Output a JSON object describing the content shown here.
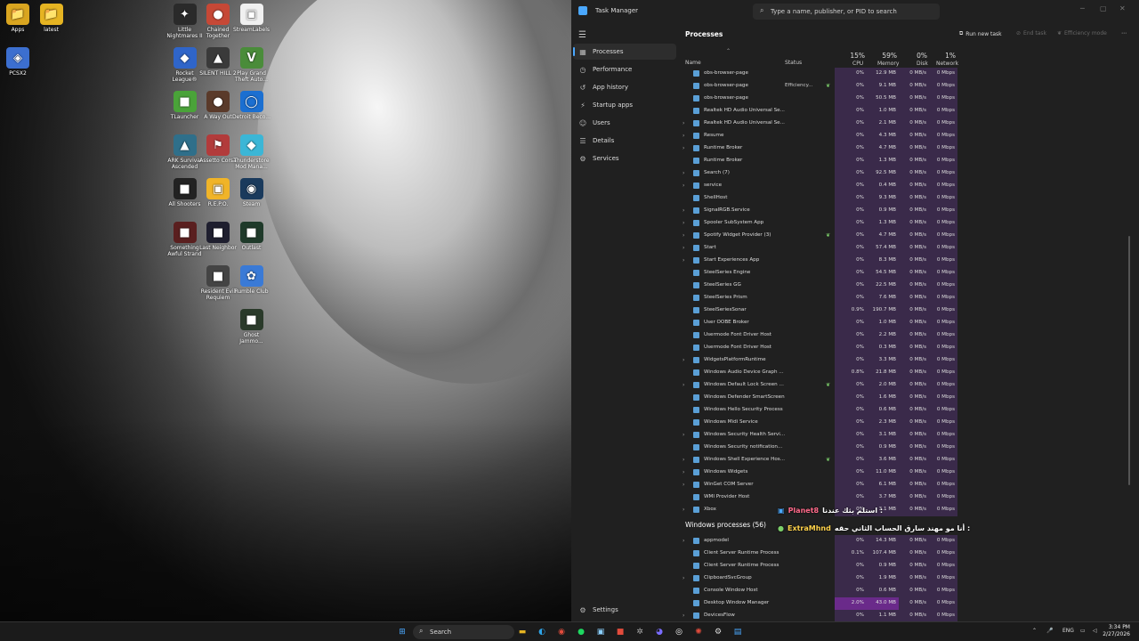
{
  "desktop": {
    "icons": [
      {
        "label": "Apps",
        "glyph": "📁",
        "color": "#d9a520"
      },
      {
        "label": "latest",
        "glyph": "📁",
        "color": "#e6b422"
      },
      {
        "label": "PCSX2",
        "glyph": "◈",
        "color": "#3c6fcf"
      },
      {
        "label": "Little Nightmares II",
        "glyph": "✦",
        "color": "#2a2a2a"
      },
      {
        "label": "Chained Together",
        "glyph": "●",
        "color": "#c64836"
      },
      {
        "label": "StreamLabels",
        "glyph": "▣",
        "color": "#f0f0f0"
      },
      {
        "label": "Rocket League®",
        "glyph": "◆",
        "color": "#2f65c9"
      },
      {
        "label": "SILENT HILL 2",
        "glyph": "▲",
        "color": "#3a3a3a"
      },
      {
        "label": "Play Grand Theft Auto...",
        "glyph": "V",
        "color": "#4a8c3a"
      },
      {
        "label": "TLauncher",
        "glyph": "■",
        "color": "#4aa339"
      },
      {
        "label": "A Way Out",
        "glyph": "●",
        "color": "#5a3a2a"
      },
      {
        "label": "Detroit Beco...",
        "glyph": "◯",
        "color": "#1b6fd1"
      },
      {
        "label": "ARK Survival Ascended",
        "glyph": "▲",
        "color": "#2f6f8a"
      },
      {
        "label": "Assetto Corsa",
        "glyph": "⚑",
        "color": "#b23b3b"
      },
      {
        "label": "Thunderstore Mod Mana...",
        "glyph": "◆",
        "color": "#3bb6d6"
      },
      {
        "label": "All Shooters",
        "glyph": "■",
        "color": "#222222"
      },
      {
        "label": "R.E.P.O.",
        "glyph": "▣",
        "color": "#f0b428"
      },
      {
        "label": "Steam",
        "glyph": "◉",
        "color": "#1a3a5c"
      },
      {
        "label": "Something Awful Strand",
        "glyph": "■",
        "color": "#5a1f1f"
      },
      {
        "label": "Last Neighbor",
        "glyph": "■",
        "color": "#1f1f2f"
      },
      {
        "label": "Outlast",
        "glyph": "■",
        "color": "#1f3a2a"
      },
      {
        "label": "Resident Evil Requiem",
        "glyph": "■",
        "color": "#444444"
      },
      {
        "label": "Rumble Club",
        "glyph": "✿",
        "color": "#3a7ad6"
      },
      {
        "label": "Ghost Jammo...",
        "glyph": "■",
        "color": "#2a3a2a"
      }
    ]
  },
  "taskmanager": {
    "title": "Task Manager",
    "search_placeholder": "Type a name, publisher, or PID to search",
    "nav": [
      {
        "label": "Processes",
        "icon": "▦"
      },
      {
        "label": "Performance",
        "icon": "◷"
      },
      {
        "label": "App history",
        "icon": "↺"
      },
      {
        "label": "Startup apps",
        "icon": "⚡"
      },
      {
        "label": "Users",
        "icon": "☺"
      },
      {
        "label": "Details",
        "icon": "☰"
      },
      {
        "label": "Services",
        "icon": "⚙"
      }
    ],
    "settings_label": "Settings",
    "page_title": "Processes",
    "run_new_task": "Run new task",
    "end_task": "End task",
    "efficiency_mode": "Efficiency mode",
    "columns": {
      "name": "Name",
      "status": "Status",
      "cpu_pct": "15%",
      "cpu": "CPU",
      "mem_pct": "59%",
      "mem": "Memory",
      "disk_pct": "0%",
      "disk": "Disk",
      "net_pct": "1%",
      "net": "Network"
    },
    "rows": [
      {
        "name": "obs-browser-page",
        "status": "",
        "cpu": "0%",
        "mem": "12.9 MB",
        "disk": "0 MB/s",
        "net": "0 Mbps",
        "exp": false
      },
      {
        "name": "obs-browser-page",
        "status": "Efficiency...",
        "leaf": true,
        "cpu": "0%",
        "mem": "9.1 MB",
        "disk": "0 MB/s",
        "net": "0 Mbps",
        "exp": false
      },
      {
        "name": "obs-browser-page",
        "status": "",
        "cpu": "0%",
        "mem": "50.5 MB",
        "disk": "0 MB/s",
        "net": "0 Mbps",
        "exp": false
      },
      {
        "name": "Realtek HD Audio Universal Se...",
        "status": "",
        "cpu": "0%",
        "mem": "1.0 MB",
        "disk": "0 MB/s",
        "net": "0 Mbps",
        "exp": false
      },
      {
        "name": "Realtek HD Audio Universal Se...",
        "status": "",
        "cpu": "0%",
        "mem": "2.1 MB",
        "disk": "0 MB/s",
        "net": "0 Mbps",
        "exp": true
      },
      {
        "name": "Resume",
        "status": "",
        "cpu": "0%",
        "mem": "4.3 MB",
        "disk": "0 MB/s",
        "net": "0 Mbps",
        "exp": true
      },
      {
        "name": "Runtime Broker",
        "status": "",
        "cpu": "0%",
        "mem": "4.7 MB",
        "disk": "0 MB/s",
        "net": "0 Mbps",
        "exp": true
      },
      {
        "name": "Runtime Broker",
        "status": "",
        "cpu": "0%",
        "mem": "1.3 MB",
        "disk": "0 MB/s",
        "net": "0 Mbps",
        "exp": false
      },
      {
        "name": "Search (7)",
        "status": "",
        "cpu": "0%",
        "mem": "92.5 MB",
        "disk": "0 MB/s",
        "net": "0 Mbps",
        "exp": true
      },
      {
        "name": "service",
        "status": "",
        "cpu": "0%",
        "mem": "0.4 MB",
        "disk": "0 MB/s",
        "net": "0 Mbps",
        "exp": true
      },
      {
        "name": "ShellHost",
        "status": "",
        "cpu": "0%",
        "mem": "9.3 MB",
        "disk": "0 MB/s",
        "net": "0 Mbps",
        "exp": false
      },
      {
        "name": "SignalRGB.Service",
        "status": "",
        "cpu": "0%",
        "mem": "0.9 MB",
        "disk": "0 MB/s",
        "net": "0 Mbps",
        "exp": true
      },
      {
        "name": "Spooler SubSystem App",
        "status": "",
        "cpu": "0%",
        "mem": "1.3 MB",
        "disk": "0 MB/s",
        "net": "0 Mbps",
        "exp": true
      },
      {
        "name": "Spotify Widget Provider (3)",
        "status": "",
        "leaf": true,
        "cpu": "0%",
        "mem": "4.7 MB",
        "disk": "0 MB/s",
        "net": "0 Mbps",
        "exp": true
      },
      {
        "name": "Start",
        "status": "",
        "cpu": "0%",
        "mem": "57.4 MB",
        "disk": "0 MB/s",
        "net": "0 Mbps",
        "exp": true
      },
      {
        "name": "Start Experiences App",
        "status": "",
        "cpu": "0%",
        "mem": "8.3 MB",
        "disk": "0 MB/s",
        "net": "0 Mbps",
        "exp": true
      },
      {
        "name": "SteelSeries Engine",
        "status": "",
        "cpu": "0%",
        "mem": "54.5 MB",
        "disk": "0 MB/s",
        "net": "0 Mbps",
        "exp": false
      },
      {
        "name": "SteelSeries GG",
        "status": "",
        "cpu": "0%",
        "mem": "22.5 MB",
        "disk": "0 MB/s",
        "net": "0 Mbps",
        "exp": false
      },
      {
        "name": "SteelSeries Prism",
        "status": "",
        "cpu": "0%",
        "mem": "7.6 MB",
        "disk": "0 MB/s",
        "net": "0 Mbps",
        "exp": false
      },
      {
        "name": "SteelSeriesSonar",
        "status": "",
        "cpu": "0.9%",
        "mem": "190.7 MB",
        "disk": "0 MB/s",
        "net": "0 Mbps",
        "exp": false
      },
      {
        "name": "User OOBE Broker",
        "status": "",
        "cpu": "0%",
        "mem": "1.0 MB",
        "disk": "0 MB/s",
        "net": "0 Mbps",
        "exp": false
      },
      {
        "name": "Usermode Font Driver Host",
        "status": "",
        "cpu": "0%",
        "mem": "2.2 MB",
        "disk": "0 MB/s",
        "net": "0 Mbps",
        "exp": false
      },
      {
        "name": "Usermode Font Driver Host",
        "status": "",
        "cpu": "0%",
        "mem": "0.3 MB",
        "disk": "0 MB/s",
        "net": "0 Mbps",
        "exp": false
      },
      {
        "name": "WidgetsPlatformRuntime",
        "status": "",
        "cpu": "0%",
        "mem": "3.3 MB",
        "disk": "0 MB/s",
        "net": "0 Mbps",
        "exp": true
      },
      {
        "name": "Windows Audio Device Graph ...",
        "status": "",
        "cpu": "0.8%",
        "mem": "21.8 MB",
        "disk": "0 MB/s",
        "net": "0 Mbps",
        "exp": false
      },
      {
        "name": "Windows Default Lock Screen ...",
        "status": "",
        "leaf": true,
        "cpu": "0%",
        "mem": "2.0 MB",
        "disk": "0 MB/s",
        "net": "0 Mbps",
        "exp": true
      },
      {
        "name": "Windows Defender SmartScreen",
        "status": "",
        "cpu": "0%",
        "mem": "1.6 MB",
        "disk": "0 MB/s",
        "net": "0 Mbps",
        "exp": false
      },
      {
        "name": "Windows Hello Security Process",
        "status": "",
        "cpu": "0%",
        "mem": "0.6 MB",
        "disk": "0 MB/s",
        "net": "0 Mbps",
        "exp": false
      },
      {
        "name": "Windows Midi Service",
        "status": "",
        "cpu": "0%",
        "mem": "2.3 MB",
        "disk": "0 MB/s",
        "net": "0 Mbps",
        "exp": false
      },
      {
        "name": "Windows Security Health Servi...",
        "status": "",
        "cpu": "0%",
        "mem": "3.1 MB",
        "disk": "0 MB/s",
        "net": "0 Mbps",
        "exp": true
      },
      {
        "name": "Windows Security notification...",
        "status": "",
        "cpu": "0%",
        "mem": "0.9 MB",
        "disk": "0 MB/s",
        "net": "0 Mbps",
        "exp": false
      },
      {
        "name": "Windows Shell Experience Hos...",
        "status": "",
        "leaf": true,
        "cpu": "0%",
        "mem": "3.6 MB",
        "disk": "0 MB/s",
        "net": "0 Mbps",
        "exp": true
      },
      {
        "name": "Windows Widgets",
        "status": "",
        "cpu": "0%",
        "mem": "11.0 MB",
        "disk": "0 MB/s",
        "net": "0 Mbps",
        "exp": true
      },
      {
        "name": "WinGet COM Server",
        "status": "",
        "cpu": "0%",
        "mem": "6.1 MB",
        "disk": "0 MB/s",
        "net": "0 Mbps",
        "exp": true
      },
      {
        "name": "WMI Provider Host",
        "status": "",
        "cpu": "0%",
        "mem": "3.7 MB",
        "disk": "0 MB/s",
        "net": "0 Mbps",
        "exp": false
      },
      {
        "name": "Xbox",
        "status": "",
        "cpu": "0%",
        "mem": "3.1 MB",
        "disk": "0 MB/s",
        "net": "0 Mbps",
        "exp": true
      }
    ],
    "group2_title": "Windows processes (56)",
    "rows2": [
      {
        "name": "appmodel",
        "cpu": "0%",
        "mem": "14.3 MB",
        "disk": "0 MB/s",
        "net": "0 Mbps",
        "exp": true
      },
      {
        "name": "Client Server Runtime Process",
        "cpu": "0.1%",
        "mem": "107.4 MB",
        "disk": "0 MB/s",
        "net": "0 Mbps",
        "exp": false
      },
      {
        "name": "Client Server Runtime Process",
        "cpu": "0%",
        "mem": "0.9 MB",
        "disk": "0 MB/s",
        "net": "0 Mbps",
        "exp": false
      },
      {
        "name": "ClipboardSvcGroup",
        "cpu": "0%",
        "mem": "1.9 MB",
        "disk": "0 MB/s",
        "net": "0 Mbps",
        "exp": true
      },
      {
        "name": "Console Window Host",
        "cpu": "0%",
        "mem": "0.6 MB",
        "disk": "0 MB/s",
        "net": "0 Mbps",
        "exp": false
      },
      {
        "name": "Desktop Window Manager",
        "cpu": "2.0%",
        "mem": "43.0 MB",
        "disk": "0 MB/s",
        "net": "0 Mbps",
        "exp": false,
        "hi": true
      },
      {
        "name": "DevicesFlow",
        "cpu": "0%",
        "mem": "1.1 MB",
        "disk": "0 MB/s",
        "net": "0 Mbps",
        "exp": true
      }
    ]
  },
  "chat": [
    {
      "user": "Planet8",
      "message": "استلم بثك عندنا :",
      "color": "#ff6a8a"
    },
    {
      "user": "ExtraMhnd",
      "message": "أنا مو مهند سارق الحساب الثاني حقه :",
      "color": "#ffd24a"
    }
  ],
  "taskbar": {
    "search_placeholder": "Search",
    "lang": "ENG",
    "time": "3:34 PM",
    "date": "2/27/2026"
  }
}
